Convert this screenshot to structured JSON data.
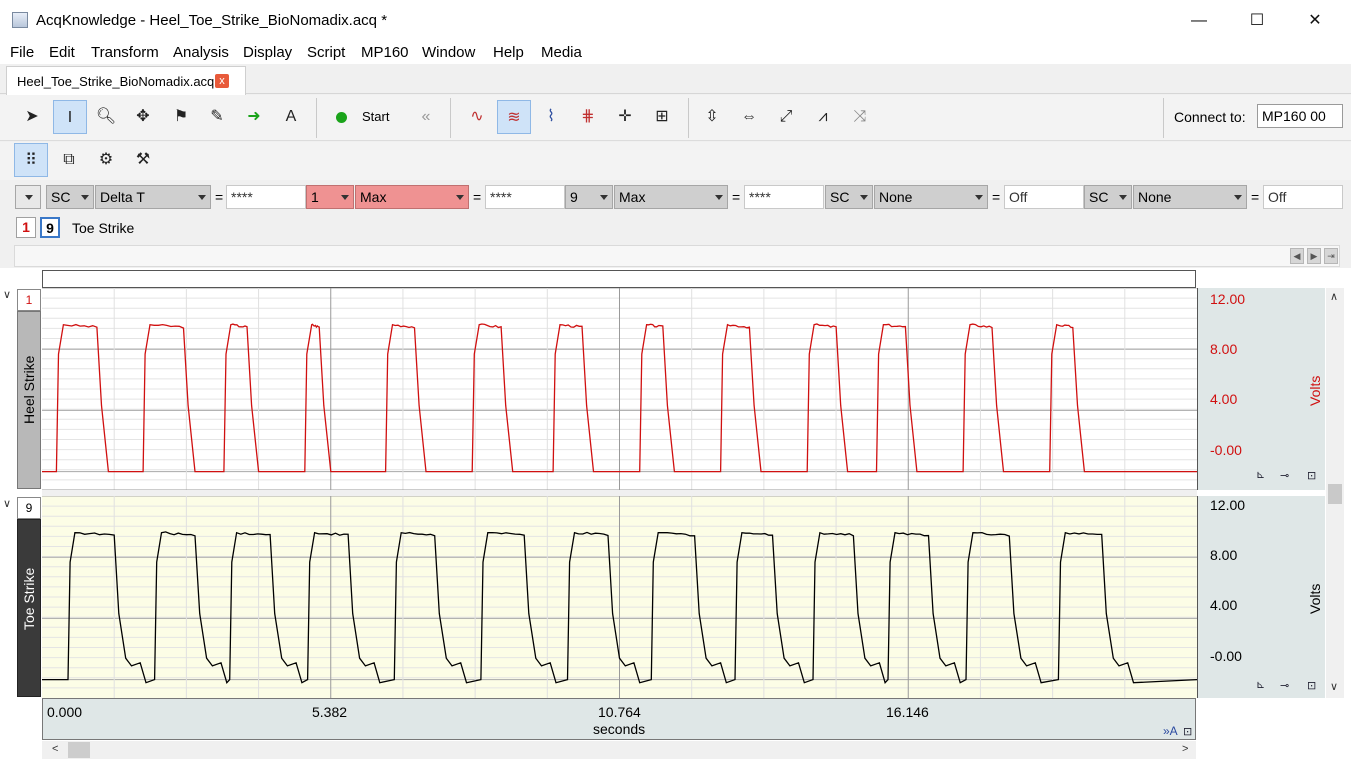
{
  "window": {
    "title": "AcqKnowledge - Heel_Toe_Strike_BioNomadix.acq *",
    "minimize": "—",
    "maximize": "☐",
    "close": "✕"
  },
  "menu": [
    "File",
    "Edit",
    "Transform",
    "Analysis",
    "Display",
    "Script",
    "MP160",
    "Window",
    "Help",
    "Media"
  ],
  "document_tab": {
    "label": "Heel_Toe_Strike_BioNomadix.acq",
    "close": "x"
  },
  "toolbar": {
    "start_label": "Start",
    "connect_label": "Connect to:",
    "connect_value": "MP160 00"
  },
  "measurements": {
    "m1": {
      "channel": "SC",
      "type": "Delta T",
      "value": "****"
    },
    "m2": {
      "channel": "1",
      "type": "Max",
      "value": "****"
    },
    "m3": {
      "channel": "9",
      "type": "Max",
      "value": "****"
    },
    "m4": {
      "channel": "SC",
      "type": "None",
      "value": "Off"
    },
    "m5": {
      "channel": "SC",
      "type": "None",
      "value": "Off"
    }
  },
  "channel_selector": {
    "ch_a": "1",
    "ch_b": "9",
    "name": "Toe Strike"
  },
  "channels": [
    {
      "number": "1",
      "label": "Heel Strike",
      "unit": "Volts",
      "ticks": [
        "12.00",
        "8.00",
        "4.00",
        "-0.00"
      ],
      "color": "#d01010"
    },
    {
      "number": "9",
      "label": "Toe Strike",
      "unit": "Volts",
      "ticks": [
        "12.00",
        "8.00",
        "4.00",
        "-0.00"
      ],
      "color": "#000000"
    }
  ],
  "xaxis": {
    "ticks": [
      "0.000",
      "5.382",
      "10.764",
      "16.146"
    ],
    "unit": "seconds"
  },
  "chart_data": {
    "type": "line",
    "x_unit": "seconds",
    "xlim": [
      0,
      20.0
    ],
    "series": [
      {
        "name": "Heel Strike",
        "ylim": [
          -1.2,
          12
        ],
        "pulses": [
          [
            0.25,
            0.95
          ],
          [
            1.75,
            2.45
          ],
          [
            3.15,
            3.55
          ],
          [
            4.55,
            4.8
          ],
          [
            5.95,
            6.45
          ],
          [
            7.45,
            7.95
          ],
          [
            8.85,
            9.35
          ],
          [
            10.35,
            10.75
          ],
          [
            11.75,
            12.25
          ],
          [
            13.25,
            13.75
          ],
          [
            14.45,
            14.95
          ],
          [
            15.95,
            16.45
          ],
          [
            17.45,
            17.85
          ]
        ],
        "high": 9.6,
        "low": 0
      },
      {
        "name": "Toe Strike",
        "ylim": [
          -1.2,
          12
        ],
        "pulses": [
          [
            0.45,
            1.25
          ],
          [
            1.95,
            2.65
          ],
          [
            3.25,
            3.95
          ],
          [
            4.6,
            5.3
          ],
          [
            6.1,
            6.8
          ],
          [
            7.6,
            8.35
          ],
          [
            9.1,
            9.8
          ],
          [
            10.55,
            11.3
          ],
          [
            12.0,
            12.65
          ],
          [
            13.35,
            14.05
          ],
          [
            14.65,
            15.35
          ],
          [
            16.0,
            16.75
          ],
          [
            17.6,
            18.35
          ]
        ],
        "high": 9.6,
        "low": 0
      }
    ]
  }
}
